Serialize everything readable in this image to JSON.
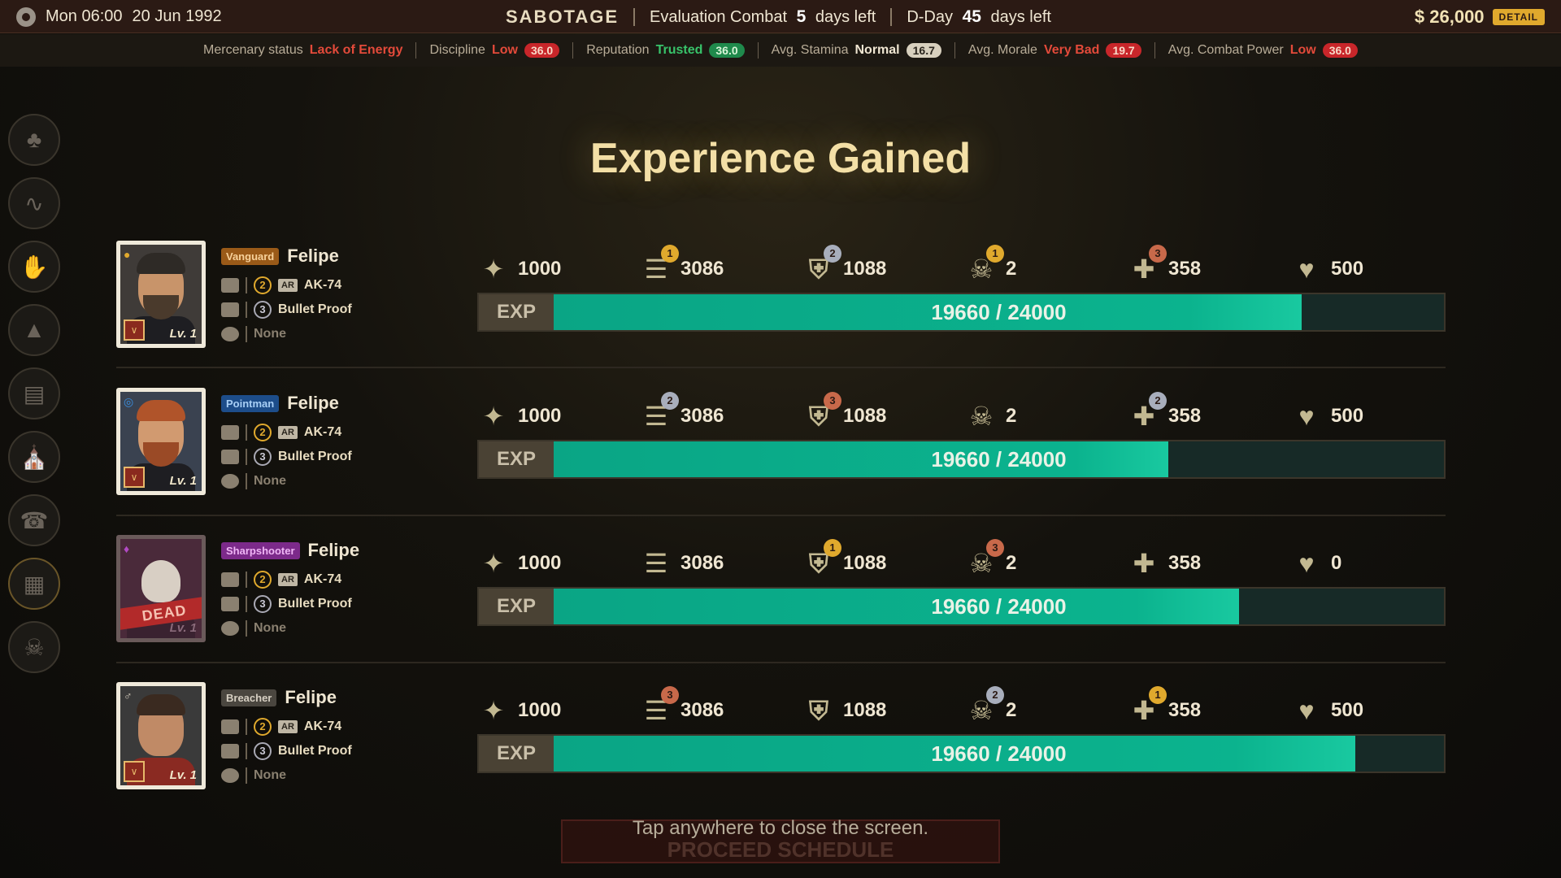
{
  "topbar": {
    "day": "Mon 06:00",
    "date": "20 Jun 1992",
    "mission": "SABOTAGE",
    "eval_label": "Evaluation Combat",
    "eval_days": "5",
    "eval_suffix": "days left",
    "dday_label": "D-Day",
    "dday_days": "45",
    "dday_suffix": "days left",
    "money": "$ 26,000",
    "detail_label": "DETAIL"
  },
  "statusbar": {
    "mercenary_status_label": "Mercenary status",
    "mercenary_status_value": "Lack of Energy",
    "discipline_label": "Discipline",
    "discipline_value": "Low",
    "discipline_num": "36.0",
    "reputation_label": "Reputation",
    "reputation_value": "Trusted",
    "reputation_num": "36.0",
    "stamina_label": "Avg. Stamina",
    "stamina_value": "Normal",
    "stamina_num": "16.7",
    "morale_label": "Avg. Morale",
    "morale_value": "Very Bad",
    "morale_num": "19.7",
    "combat_label": "Avg. Combat Power",
    "combat_value": "Low",
    "combat_num": "36.0"
  },
  "sidebar_icons": [
    "cards-icon",
    "route-icon",
    "handshake-icon",
    "stamp-icon",
    "money-icon",
    "building-icon",
    "radio-icon",
    "documents-icon",
    "skull-crossbones-icon"
  ],
  "heading": "Experience Gained",
  "mercs": [
    {
      "role": "Vanguard",
      "role_class": "role-vanguard",
      "name": "Felipe",
      "level": "Lv. 1",
      "weapon_grade": "2",
      "weapon_type": "AR",
      "weapon": "AK-74",
      "armor_grade": "3",
      "armor": "Bullet Proof",
      "accessory": "None",
      "dead": false,
      "stats": [
        {
          "icon": "crosshair-icon",
          "value": "1000",
          "medal": "",
          "medal_class": ""
        },
        {
          "icon": "bullets-icon",
          "value": "3086",
          "medal": "1",
          "medal_class": "medal-gold"
        },
        {
          "icon": "shield-icon",
          "value": "1088",
          "medal": "2",
          "medal_class": "medal-silver"
        },
        {
          "icon": "skull-icon",
          "value": "2",
          "medal": "1",
          "medal_class": "medal-gold"
        },
        {
          "icon": "medkit-icon",
          "value": "358",
          "medal": "3",
          "medal_class": "medal-bronze"
        },
        {
          "icon": "heart-icon",
          "value": "500",
          "medal": "",
          "medal_class": ""
        }
      ],
      "exp_label": "EXP",
      "exp_text": "19660 / 24000",
      "exp_fill": 0.84
    },
    {
      "role": "Pointman",
      "role_class": "role-pointman",
      "name": "Felipe",
      "level": "Lv. 1",
      "weapon_grade": "2",
      "weapon_type": "AR",
      "weapon": "AK-74",
      "armor_grade": "3",
      "armor": "Bullet Proof",
      "accessory": "None",
      "dead": false,
      "stats": [
        {
          "icon": "crosshair-icon",
          "value": "1000",
          "medal": "",
          "medal_class": ""
        },
        {
          "icon": "bullets-icon",
          "value": "3086",
          "medal": "2",
          "medal_class": "medal-silver"
        },
        {
          "icon": "shield-icon",
          "value": "1088",
          "medal": "3",
          "medal_class": "medal-bronze"
        },
        {
          "icon": "skull-icon",
          "value": "2",
          "medal": "",
          "medal_class": ""
        },
        {
          "icon": "medkit-icon",
          "value": "358",
          "medal": "2",
          "medal_class": "medal-silver"
        },
        {
          "icon": "heart-icon",
          "value": "500",
          "medal": "",
          "medal_class": ""
        }
      ],
      "exp_label": "EXP",
      "exp_text": "19660 / 24000",
      "exp_fill": 0.69
    },
    {
      "role": "Sharpshooter",
      "role_class": "role-sharpshooter",
      "name": "Felipe",
      "level": "Lv. 1",
      "weapon_grade": "2",
      "weapon_type": "AR",
      "weapon": "AK-74",
      "armor_grade": "3",
      "armor": "Bullet Proof",
      "accessory": "None",
      "dead": true,
      "dead_label": "DEAD",
      "stats": [
        {
          "icon": "crosshair-icon",
          "value": "1000",
          "medal": "",
          "medal_class": ""
        },
        {
          "icon": "bullets-icon",
          "value": "3086",
          "medal": "",
          "medal_class": ""
        },
        {
          "icon": "shield-icon",
          "value": "1088",
          "medal": "1",
          "medal_class": "medal-gold"
        },
        {
          "icon": "skull-icon",
          "value": "2",
          "medal": "3",
          "medal_class": "medal-bronze"
        },
        {
          "icon": "medkit-icon",
          "value": "358",
          "medal": "",
          "medal_class": ""
        },
        {
          "icon": "heart-icon",
          "value": "0",
          "medal": "",
          "medal_class": ""
        }
      ],
      "exp_label": "EXP",
      "exp_text": "19660 / 24000",
      "exp_fill": 0.77
    },
    {
      "role": "Breacher",
      "role_class": "role-breacher",
      "name": "Felipe",
      "level": "Lv. 1",
      "weapon_grade": "2",
      "weapon_type": "AR",
      "weapon": "AK-74",
      "armor_grade": "3",
      "armor": "Bullet Proof",
      "accessory": "None",
      "dead": false,
      "stats": [
        {
          "icon": "crosshair-icon",
          "value": "1000",
          "medal": "",
          "medal_class": ""
        },
        {
          "icon": "bullets-icon",
          "value": "3086",
          "medal": "3",
          "medal_class": "medal-bronze"
        },
        {
          "icon": "shield-icon",
          "value": "1088",
          "medal": "",
          "medal_class": ""
        },
        {
          "icon": "skull-icon",
          "value": "2",
          "medal": "2",
          "medal_class": "medal-silver"
        },
        {
          "icon": "medkit-icon",
          "value": "358",
          "medal": "1",
          "medal_class": "medal-gold"
        },
        {
          "icon": "heart-icon",
          "value": "500",
          "medal": "",
          "medal_class": ""
        }
      ],
      "exp_label": "EXP",
      "exp_text": "19660 / 24000",
      "exp_fill": 0.9
    }
  ],
  "footer": {
    "hint": "Tap anywhere to close the screen.",
    "proceed": "PROCEED SCHEDULE"
  }
}
